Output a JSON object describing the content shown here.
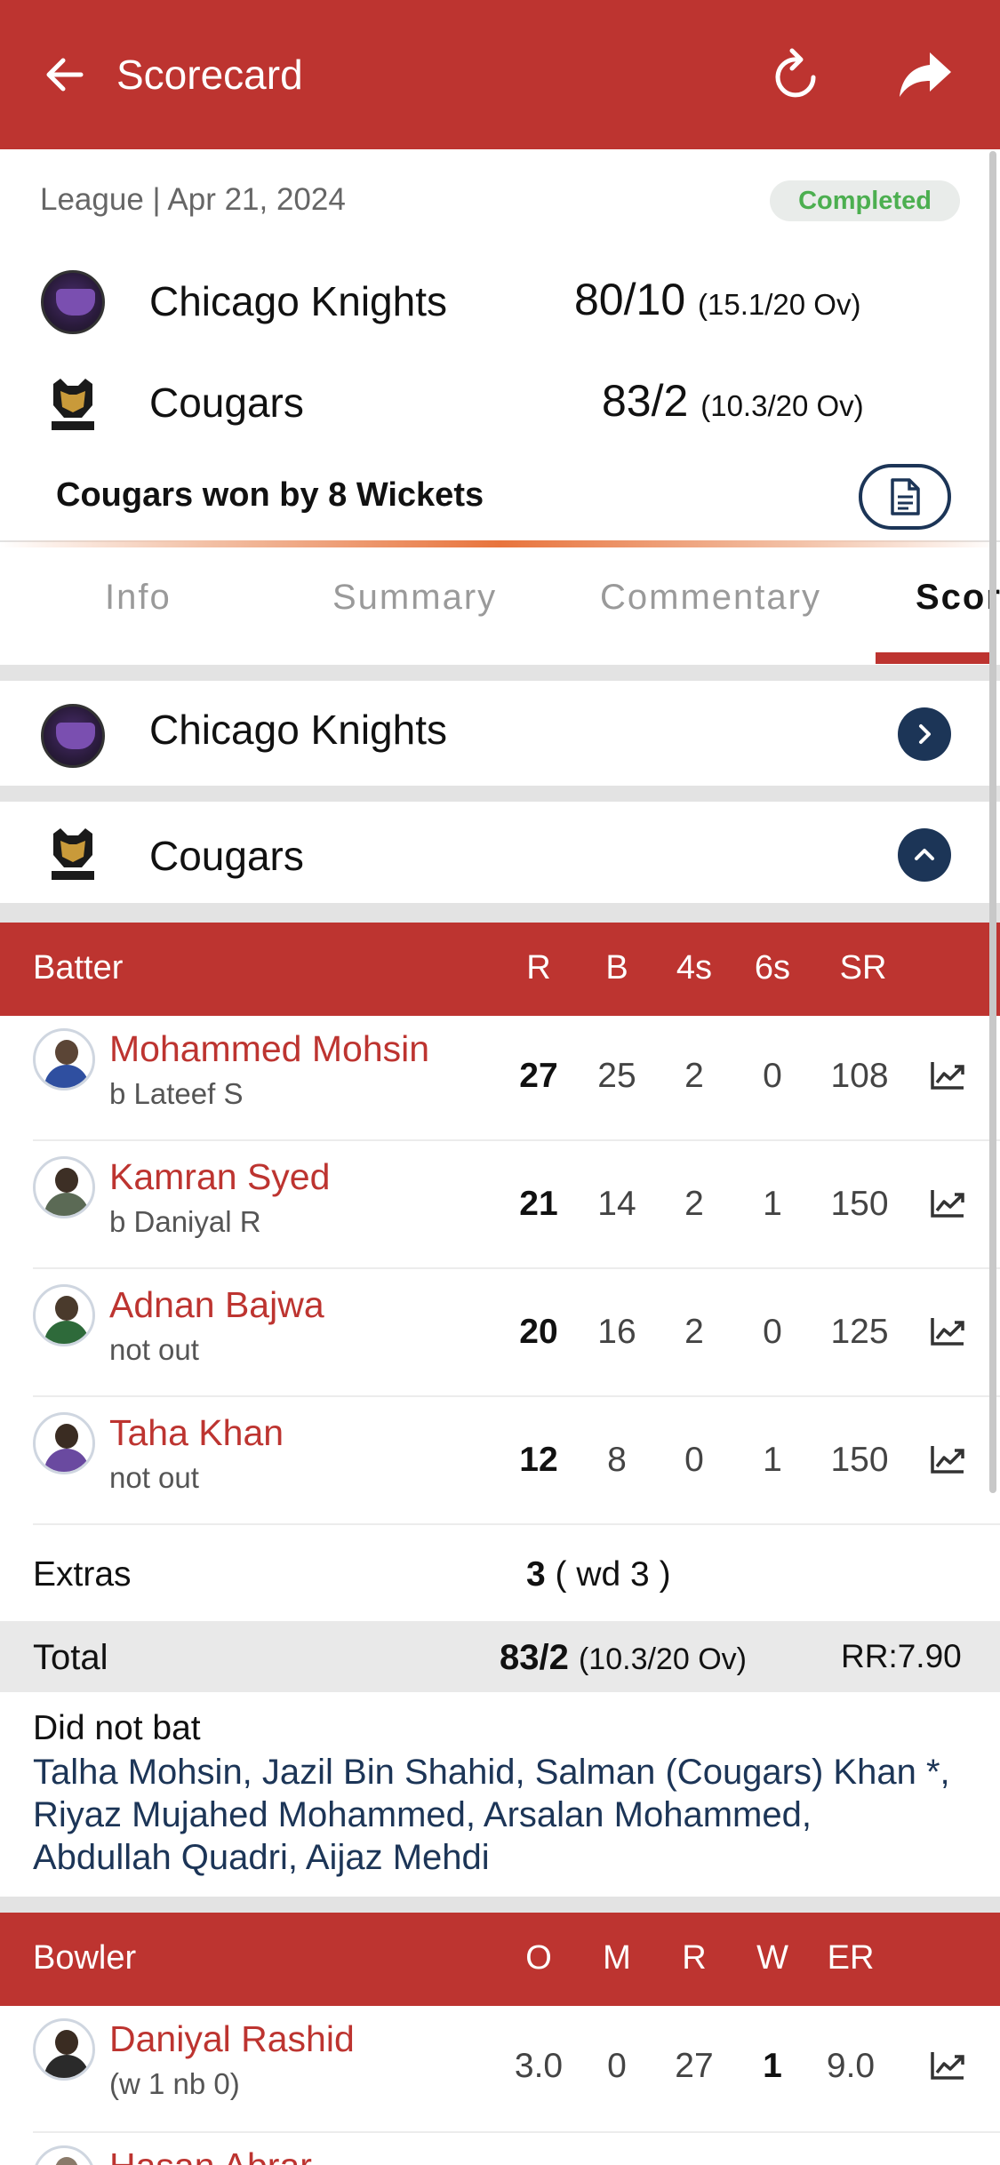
{
  "header": {
    "title": "Scorecard",
    "back_icon": "arrow-left-icon",
    "refresh_icon": "refresh-icon",
    "share_icon": "share-icon"
  },
  "match": {
    "meta": "League | Apr 21, 2024",
    "status": "Completed",
    "result": "Cougars won by 8 Wickets",
    "teams": [
      {
        "name": "Chicago Knights",
        "score": "80/10",
        "overs": "(15.1/20 Ov)"
      },
      {
        "name": "Cougars",
        "score": "83/2",
        "overs": "(10.3/20 Ov)"
      }
    ]
  },
  "tabs": [
    "Info",
    "Summary",
    "Commentary",
    "Scorecard"
  ],
  "active_tab": "Scorecard",
  "innings": [
    {
      "name": "Chicago Knights",
      "expanded": false
    },
    {
      "name": "Cougars",
      "expanded": true
    }
  ],
  "batting": {
    "headers": {
      "player": "Batter",
      "r": "R",
      "b": "B",
      "fours": "4s",
      "sixes": "6s",
      "sr": "SR"
    },
    "rows": [
      {
        "name": "Mohammed Mohsin",
        "dismissal": "b Lateef S",
        "r": "27",
        "b": "25",
        "fours": "2",
        "sixes": "0",
        "sr": "108"
      },
      {
        "name": "Kamran Syed",
        "dismissal": "b Daniyal R",
        "r": "21",
        "b": "14",
        "fours": "2",
        "sixes": "1",
        "sr": "150"
      },
      {
        "name": "Adnan Bajwa",
        "dismissal": "not out",
        "r": "20",
        "b": "16",
        "fours": "2",
        "sixes": "0",
        "sr": "125"
      },
      {
        "name": "Taha Khan",
        "dismissal": "not out",
        "r": "12",
        "b": "8",
        "fours": "0",
        "sixes": "1",
        "sr": "150"
      }
    ],
    "extras_label": "Extras",
    "extras_total": "3",
    "extras_detail": "( wd 3 )",
    "total_label": "Total",
    "total_score": "83/2",
    "total_overs": "(10.3/20 Ov)",
    "run_rate": "RR:7.90",
    "did_not_bat_label": "Did not bat",
    "did_not_bat": "Talha Mohsin, Jazil Bin Shahid, Salman (Cougars) Khan *, Riyaz Mujahed Mohammed, Arsalan Mohammed, Abdullah Quadri, Aijaz Mehdi"
  },
  "bowling": {
    "headers": {
      "player": "Bowler",
      "o": "O",
      "m": "M",
      "r": "R",
      "w": "W",
      "er": "ER"
    },
    "rows": [
      {
        "name": "Daniyal Rashid",
        "detail": "(w 1 nb 0)",
        "o": "3.0",
        "m": "0",
        "r": "27",
        "w": "1",
        "er": "9.0"
      },
      {
        "name": "Hasan Abrar",
        "detail": "",
        "o": "",
        "m": "",
        "r": "",
        "w": "",
        "er": ""
      }
    ]
  },
  "colors": {
    "primary": "#bd3430",
    "navy": "#1c3557",
    "success": "#4caf50"
  }
}
